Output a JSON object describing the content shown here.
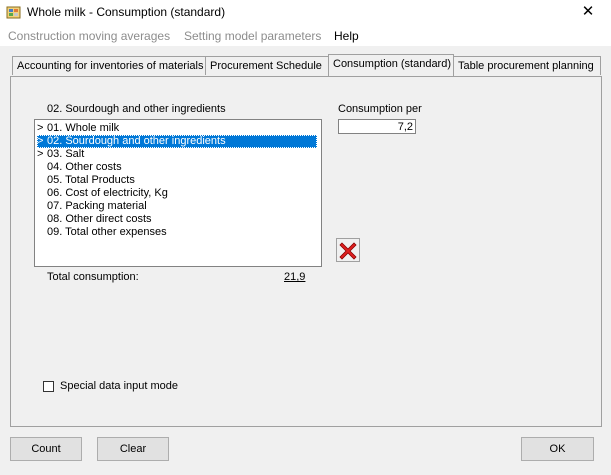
{
  "window": {
    "title": "Whole milk - Consumption (standard)",
    "close_glyph": "✕"
  },
  "menu": [
    {
      "label": "Construction moving averages"
    },
    {
      "label": "Setting model parameters"
    },
    {
      "label": "Help"
    }
  ],
  "tabs": [
    {
      "label": "Accounting for inventories of materials"
    },
    {
      "label": "Procurement Schedule"
    },
    {
      "label": "Consumption (standard)"
    },
    {
      "label": "Table procurement planning"
    }
  ],
  "list": {
    "header": "02. Sourdough and other ingredients",
    "items": [
      {
        "arrow": ">",
        "label": "01. Whole milk"
      },
      {
        "arrow": ">",
        "label": "02. Sourdough and other ingredients"
      },
      {
        "arrow": ">",
        "label": "03. Salt"
      },
      {
        "arrow": "",
        "label": "04. Other costs"
      },
      {
        "arrow": "",
        "label": "05. Total Products"
      },
      {
        "arrow": "",
        "label": "06. Cost of electricity, Kg"
      },
      {
        "arrow": "",
        "label": "07. Packing material"
      },
      {
        "arrow": "",
        "label": "08. Other direct costs"
      },
      {
        "arrow": "",
        "label": "09. Total other expenses"
      }
    ]
  },
  "consumption": {
    "label": "Consumption per",
    "value": "7,2"
  },
  "total": {
    "label": "Total consumption:",
    "value": "21,9"
  },
  "special_mode": {
    "label": "Special data input mode"
  },
  "buttons": {
    "count": "Count",
    "clear": "Clear",
    "ok": "OK"
  }
}
